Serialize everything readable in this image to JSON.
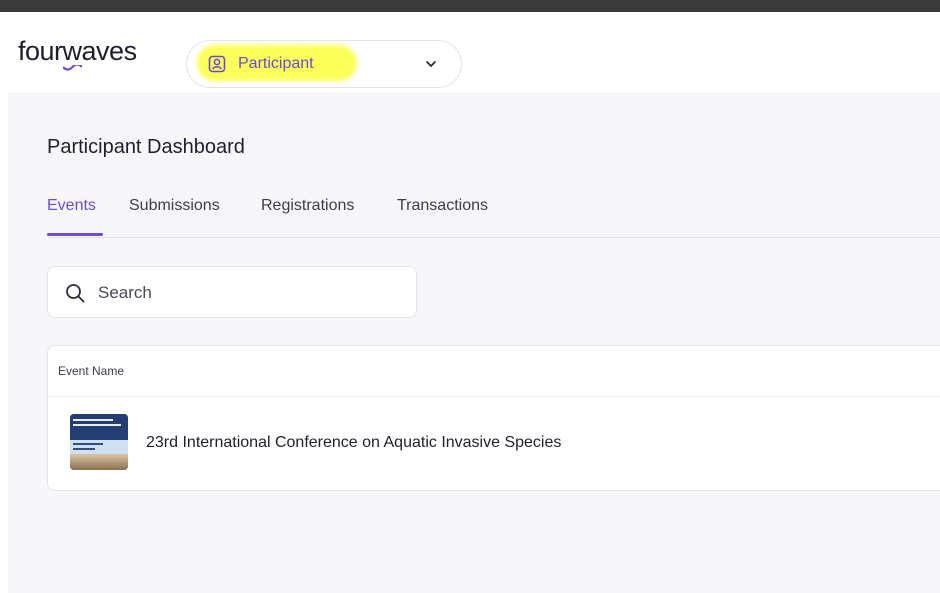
{
  "app": {
    "logo_text_before": "four",
    "logo_text_w": "W",
    "logo_text_after": "aves",
    "brand_color": "#6c4cd6"
  },
  "role_selector": {
    "label": "Participant",
    "icon": "user-badge-icon",
    "chevron": "chevron-down-icon"
  },
  "page": {
    "title": "Participant Dashboard"
  },
  "tabs": [
    {
      "label": "Events",
      "active": true
    },
    {
      "label": "Submissions",
      "active": false
    },
    {
      "label": "Registrations",
      "active": false
    },
    {
      "label": "Transactions",
      "active": false
    }
  ],
  "search": {
    "placeholder": "Search",
    "value": "",
    "icon": "search-icon"
  },
  "table": {
    "columns": [
      "Event Name"
    ],
    "rows": [
      {
        "name": "23rd International Conference on Aquatic Invasive Species"
      }
    ]
  }
}
